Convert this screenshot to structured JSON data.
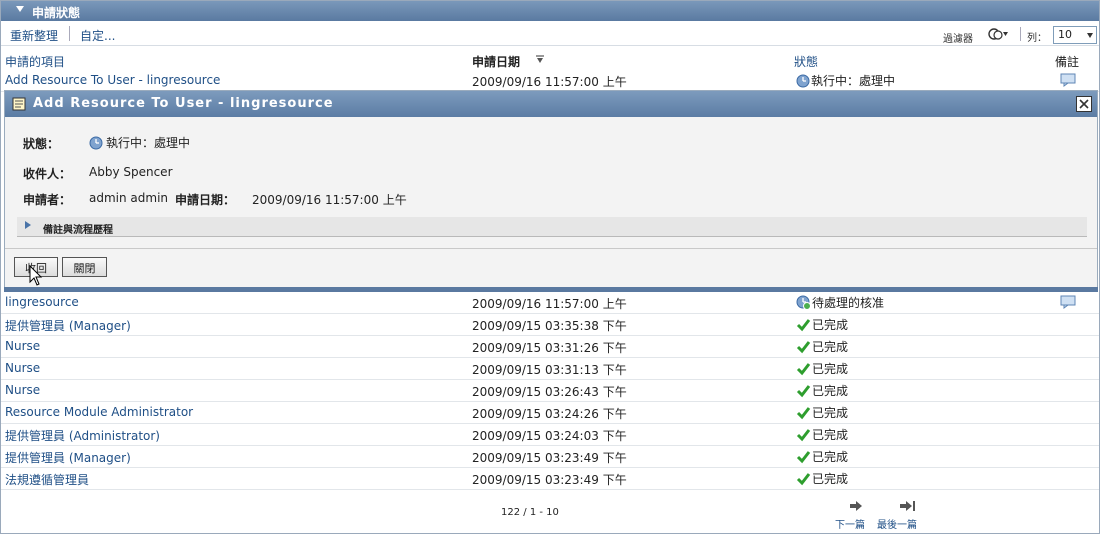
{
  "panel": {
    "title": "申請狀態"
  },
  "toolbar": {
    "refresh": "重新整理",
    "customize": "自定...",
    "filter": "過濾器",
    "rows_label": "列：",
    "rows_value": "10"
  },
  "columns": {
    "item": "申請的項目",
    "date": "申請日期",
    "status": "狀態",
    "notes": "備註"
  },
  "first_row": {
    "item": "Add Resource To User - lingresource",
    "date": "2009/09/16 11:57:00 上午",
    "status": "執行中：處理中"
  },
  "detail": {
    "title": "Add Resource To User - lingresource",
    "status_label": "狀態：",
    "status_value": "執行中：處理中",
    "recipient_label": "收件人：",
    "recipient_value": "Abby Spencer",
    "requester_label": "申請者：",
    "requester_value": "admin admin",
    "date_label": "申請日期：",
    "date_value": "2009/09/16 11:57:00 上午",
    "comments_label": "備註與流程歷程",
    "withdraw_button": "收回",
    "close_button": "關閉"
  },
  "rows": [
    {
      "item": "lingresource",
      "date": "2009/09/16 11:57:00 上午",
      "status": "待處理的核准",
      "icon": "pending-clock-icon",
      "note": true
    },
    {
      "item": "提供管理員 (Manager)",
      "date": "2009/09/15 03:35:38 下午",
      "status": "已完成",
      "icon": "check-icon"
    },
    {
      "item": "Nurse",
      "date": "2009/09/15 03:31:26 下午",
      "status": "已完成",
      "icon": "check-icon"
    },
    {
      "item": "Nurse",
      "date": "2009/09/15 03:31:13 下午",
      "status": "已完成",
      "icon": "check-icon"
    },
    {
      "item": "Nurse",
      "date": "2009/09/15 03:26:43 下午",
      "status": "已完成",
      "icon": "check-icon"
    },
    {
      "item": "Resource Module Administrator",
      "date": "2009/09/15 03:24:26 下午",
      "status": "已完成",
      "icon": "check-icon"
    },
    {
      "item": "提供管理員 (Administrator)",
      "date": "2009/09/15 03:24:03 下午",
      "status": "已完成",
      "icon": "check-icon"
    },
    {
      "item": "提供管理員 (Manager)",
      "date": "2009/09/15 03:23:49 下午",
      "status": "已完成",
      "icon": "check-icon"
    },
    {
      "item": "法規遵循管理員",
      "date": "2009/09/15 03:23:49 下午",
      "status": "已完成",
      "icon": "check-icon"
    }
  ],
  "footer": {
    "count": "122 / 1 - 10",
    "next": "下一篇",
    "last": "最後一篇"
  },
  "colors": {
    "header_blue": "#5a7aa1",
    "link": "#1f4f86",
    "check_green": "#2e9e2e"
  }
}
